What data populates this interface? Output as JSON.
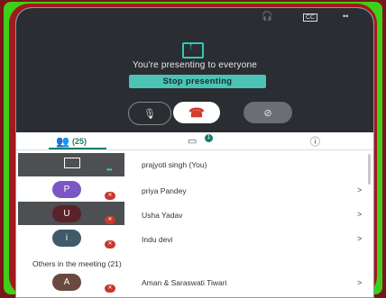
{
  "status_bar": {
    "headset_icon": "headset-icon",
    "cc_icon": "captions-icon",
    "more_icon": "more-icon"
  },
  "presenting": {
    "message": "You're presenting to everyone",
    "stop_label": "Stop presenting"
  },
  "controls": {
    "mic_icon": "mic-icon",
    "end_call_icon": "end-call-icon",
    "camera_off_icon": "camera-off-icon"
  },
  "tabs": {
    "people_count": "(25)",
    "chat_badge": "1"
  },
  "participants": [
    {
      "name": "prajyoti singh (You)",
      "initial": "",
      "color": "#4d4f52"
    },
    {
      "name": "priya Pandey",
      "initial": "P",
      "color": "#7b56c4"
    },
    {
      "name": "Usha Yadav",
      "initial": "U",
      "color": "#5a2229"
    },
    {
      "name": "Indu devi",
      "initial": "i",
      "color": "#3f5a68"
    }
  ],
  "others_label": "Others in the meeting (21)",
  "others": [
    {
      "name": "Aman & Saraswati Tiwari",
      "initial": "A",
      "color": "#6a4a3e"
    }
  ],
  "chevron": ">",
  "colors": {
    "accent": "#1b7b6f",
    "teal_button": "#4cc3b5",
    "mute_red": "#c8392e",
    "dark_bg": "#2a2d31"
  }
}
